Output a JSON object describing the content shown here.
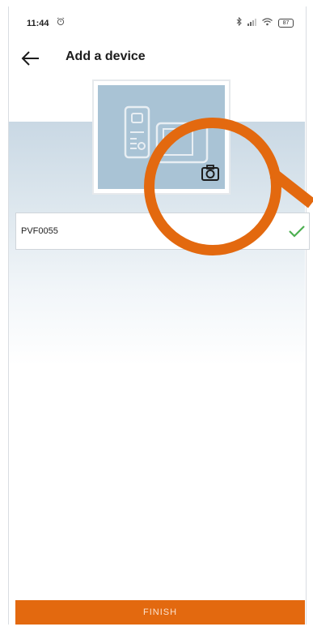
{
  "status_bar": {
    "time": "11:44",
    "alarm_icon": "alarm-icon",
    "bluetooth_icon": "bluetooth-icon",
    "signal_icon": "signal-icon",
    "wifi_icon": "wifi-icon",
    "battery_level": "87"
  },
  "header": {
    "back_icon": "arrow-left-icon",
    "title": "Add a device"
  },
  "device_card": {
    "illustration": "intercom-device-illustration",
    "camera_icon": "camera-icon"
  },
  "device_id_field": {
    "value": "PVF0055",
    "valid_icon": "checkmark-icon"
  },
  "footer": {
    "finish_label": "FINISH"
  },
  "colors": {
    "accent": "#e3690f",
    "card_background": "#a9c3d5",
    "valid_check": "#4caf50",
    "title_text": "#1c1c1c"
  }
}
